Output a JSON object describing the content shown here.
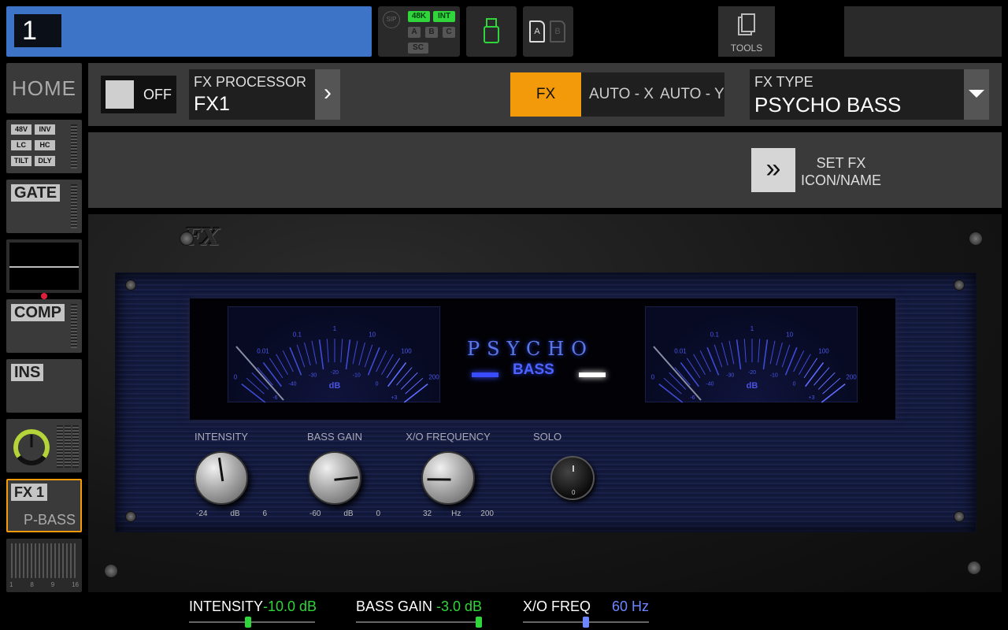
{
  "top": {
    "channel_number": "1",
    "status": {
      "sip": "SIP",
      "rate": "48K",
      "clock": "INT",
      "a": "A",
      "b": "B",
      "c": "C",
      "sc": "SC"
    },
    "sd": {
      "a": "A",
      "b": "B"
    },
    "tools_label": "TOOLS"
  },
  "sidebar": {
    "home": "HOME",
    "input": {
      "phantom": "48V",
      "inv": "INV",
      "lc": "LC",
      "hc": "HC",
      "tilt": "TILT",
      "dly": "DLY"
    },
    "gate": "GATE",
    "comp": "COMP",
    "ins": "INS",
    "fx": {
      "name": "FX 1",
      "preset": "P-BASS"
    },
    "sends_scale": [
      "1",
      "8",
      "9",
      "16"
    ]
  },
  "fx_header": {
    "power_label": "OFF",
    "processor_label": "FX PROCESSOR",
    "processor_value": "FX1",
    "tabs": [
      "FX",
      "AUTO - X",
      "AUTO - Y"
    ],
    "active_tab": "FX",
    "type_label": "FX TYPE",
    "type_value": "PSYCHO BASS",
    "set_fx_label_1": "SET FX",
    "set_fx_label_2": "ICON/NAME"
  },
  "rack": {
    "logo": "FX",
    "title_1": "PSYCHO",
    "title_2": "BASS",
    "vu_unit": "dB",
    "vu_scale_top": [
      "0",
      "0.01",
      "0.1",
      "1",
      "10",
      "100",
      "200"
    ],
    "vu_scale_bottom": [
      "-6",
      "-40",
      "-30",
      "-20",
      "-10",
      "0",
      "+3"
    ],
    "knobs": [
      {
        "label": "INTENSITY",
        "min": "-24",
        "unit": "dB",
        "max": "6",
        "level": 0.47
      },
      {
        "label": "BASS GAIN",
        "min": "-60",
        "unit": "dB",
        "max": "0",
        "level": 0.8
      },
      {
        "label": "X/O FREQUENCY",
        "min": "32",
        "unit": "Hz",
        "max": "200",
        "level": 0.18
      }
    ],
    "solo": {
      "label": "SOLO",
      "mark": "0"
    }
  },
  "params": [
    {
      "name": "INTENSITY",
      "value": "-10.0 dB",
      "color": "#2fd53a",
      "position": 0.47
    },
    {
      "name": "BASS GAIN",
      "value": "-3.0 dB",
      "color": "#2fd53a",
      "position": 1.0
    },
    {
      "name": "X/O FREQ",
      "value": "60 Hz",
      "color": "#6e86ff",
      "position": 0.5
    }
  ],
  "colors": {
    "accent": "#3d74c8",
    "tab_active": "#f39a0a",
    "fx_selected_border": "#f39a0a"
  }
}
